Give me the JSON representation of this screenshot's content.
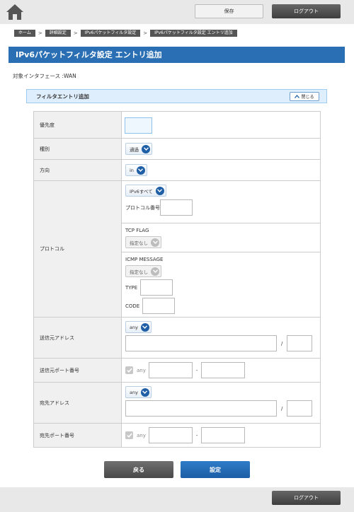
{
  "header": {
    "save_label": "保存",
    "logout_label": "ログアウト"
  },
  "breadcrumb": [
    "ホーム",
    "詳細設定",
    "IPv6パケットフィルタ設定",
    "IPv6パケットフィルタ設定 エントリ追加"
  ],
  "breadcrumb_sep": ">",
  "page_title": "IPv6パケットフィルタ設定 エントリ追加",
  "interface_text": "対象インタフェース :WAN",
  "panel": {
    "title": "フィルタエントリ追加",
    "close_label": "閉じる"
  },
  "form": {
    "priority_label": "優先度",
    "type_label": "種別",
    "type_value": "通過",
    "direction_label": "方向",
    "direction_value": "in",
    "protocol_label": "プロトコル",
    "protocol_value": "IPv6すべて",
    "protocol_number_label": "プロトコル番号",
    "tcp_flag_label": "TCP FLAG",
    "tcp_flag_value": "指定なし",
    "icmp_label": "ICMP MESSAGE",
    "icmp_value": "指定なし",
    "icmp_type_label": "TYPE",
    "icmp_code_label": "CODE",
    "src_addr_label": "送信元アドレス",
    "src_addr_value": "any",
    "slash": "/",
    "src_port_label": "送信元ポート番号",
    "src_port_any": "any",
    "dash": "-",
    "dst_addr_label": "宛先アドレス",
    "dst_addr_value": "any",
    "dst_port_label": "宛先ポート番号",
    "dst_port_any": "any"
  },
  "buttons": {
    "back_label": "戻る",
    "set_label": "設定"
  },
  "footer": {
    "logout_label": "ログアウト"
  },
  "colors": {
    "accent": "#2a6fb4",
    "panel_bg": "#dfeefd",
    "select_chevron": "#1e5fa6"
  }
}
